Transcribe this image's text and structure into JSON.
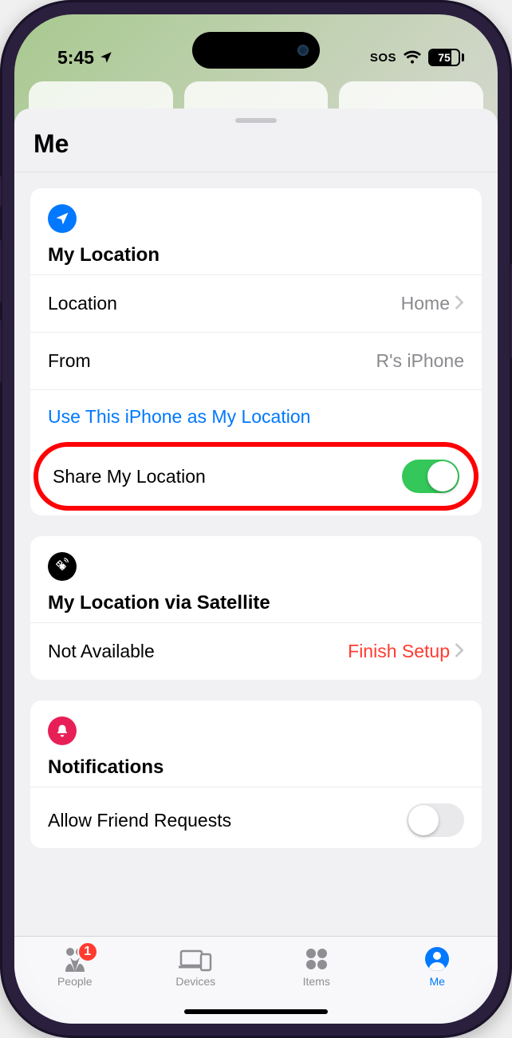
{
  "statusbar": {
    "time": "5:45",
    "sos": "SOS",
    "battery_pct": "75"
  },
  "sheet": {
    "title": "Me"
  },
  "my_location": {
    "title": "My Location",
    "location_label": "Location",
    "location_value": "Home",
    "from_label": "From",
    "from_value": "R's iPhone",
    "use_this_link": "Use This iPhone as My Location",
    "share_label": "Share My Location",
    "share_on": true
  },
  "satellite": {
    "title": "My Location via Satellite",
    "status_label": "Not Available",
    "action_label": "Finish Setup"
  },
  "notifications": {
    "title": "Notifications",
    "friend_req_label": "Allow Friend Requests",
    "friend_req_on": false
  },
  "tabs": {
    "people": "People",
    "people_badge": "1",
    "devices": "Devices",
    "items": "Items",
    "me": "Me"
  }
}
